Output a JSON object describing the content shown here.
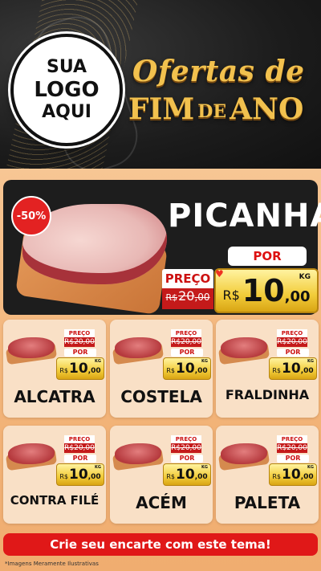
{
  "header": {
    "logo_lines": [
      "SUA",
      "LOGO",
      "AQUI"
    ],
    "title_line1": "Ofertas de",
    "title_line2_a": "FIM",
    "title_line2_de": "DE",
    "title_line2_b": "ANO"
  },
  "hero": {
    "discount_badge": "-50%",
    "name": "PICANHA",
    "por_label": "POR",
    "preco_label": "PREÇO",
    "old_price": {
      "currency": "R$",
      "integer": "20",
      "cents": ",00"
    },
    "new_price": {
      "currency": "R$",
      "integer": "10",
      "cents": ",00",
      "unit": "KG"
    }
  },
  "products": [
    {
      "name": "ALCATRA",
      "preco_label": "PREÇO",
      "old_price": "R$20,00",
      "por_label": "POR",
      "currency": "R$",
      "integer": "10",
      "cents": ",00",
      "unit": "KG"
    },
    {
      "name": "COSTELA",
      "preco_label": "PREÇO",
      "old_price": "R$20,00",
      "por_label": "POR",
      "currency": "R$",
      "integer": "10",
      "cents": ",00",
      "unit": "KG"
    },
    {
      "name": "FRALDINHA",
      "preco_label": "PREÇO",
      "old_price": "R$20,00",
      "por_label": "POR",
      "currency": "R$",
      "integer": "10",
      "cents": ",00",
      "unit": "KG"
    },
    {
      "name": "CONTRA FILÉ",
      "preco_label": "PREÇO",
      "old_price": "R$20,00",
      "por_label": "POR",
      "currency": "R$",
      "integer": "10",
      "cents": ",00",
      "unit": "KG"
    },
    {
      "name": "ACÉM",
      "preco_label": "PREÇO",
      "old_price": "R$20,00",
      "por_label": "POR",
      "currency": "R$",
      "integer": "10",
      "cents": ",00",
      "unit": "KG"
    },
    {
      "name": "PALETA",
      "preco_label": "PREÇO",
      "old_price": "R$20,00",
      "por_label": "POR",
      "currency": "R$",
      "integer": "10",
      "cents": ",00",
      "unit": "KG"
    }
  ],
  "cta": {
    "label": "Crie seu encarte com este tema!"
  },
  "footer": {
    "disclaimer": "*Imagens Meramente Ilustrativas"
  },
  "colors": {
    "accent_red": "#e01818",
    "gold": "#f2c14e",
    "price_yellow": "#f2cc3a",
    "background_peach": "#f3b57a"
  },
  "icons": [
    "heart-icon"
  ]
}
